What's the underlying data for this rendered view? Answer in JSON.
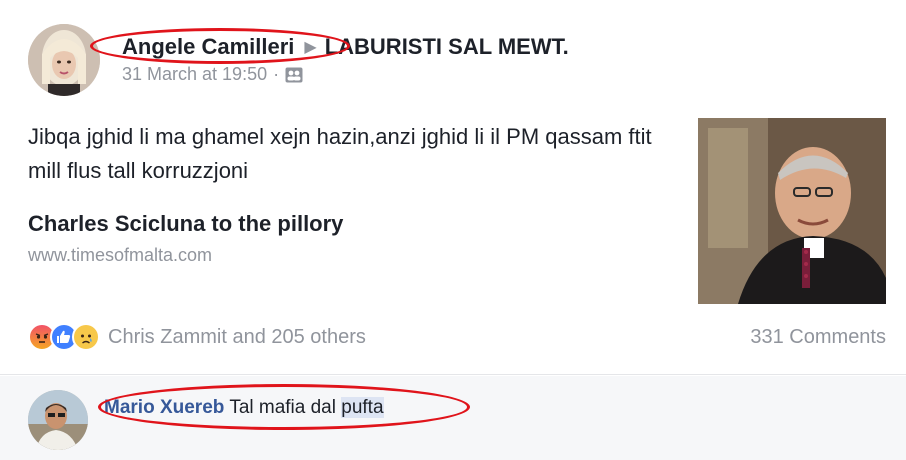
{
  "post": {
    "author": "Angele Camilleri",
    "group": "LABURISTI SAL MEWT.",
    "timestamp": "31 March at 19:50",
    "separator": "·",
    "audience_icon": "group-audience-icon",
    "text": "Jibqa jghid li ma ghamel xejn hazin,anzi jghid li il PM qassam ftit mill flus tall korruzzjoni",
    "link": {
      "title": "Charles Scicluna to the pillory",
      "domain": "www.timesofmalta.com"
    },
    "reactions": {
      "icons": [
        "angry-reaction-icon",
        "like-reaction-icon",
        "sad-reaction-icon"
      ],
      "summary": "Chris Zammit and 205 others"
    },
    "comments_count": "331 Comments"
  },
  "comment": {
    "author": "Mario Xuereb",
    "text_plain": "Tal mafia dal",
    "text_highlight": "pufta"
  },
  "colors": {
    "link_blue": "#365899",
    "meta_gray": "#90949c",
    "annotation_red": "#e0141b",
    "comment_bg": "#f6f7f9"
  }
}
